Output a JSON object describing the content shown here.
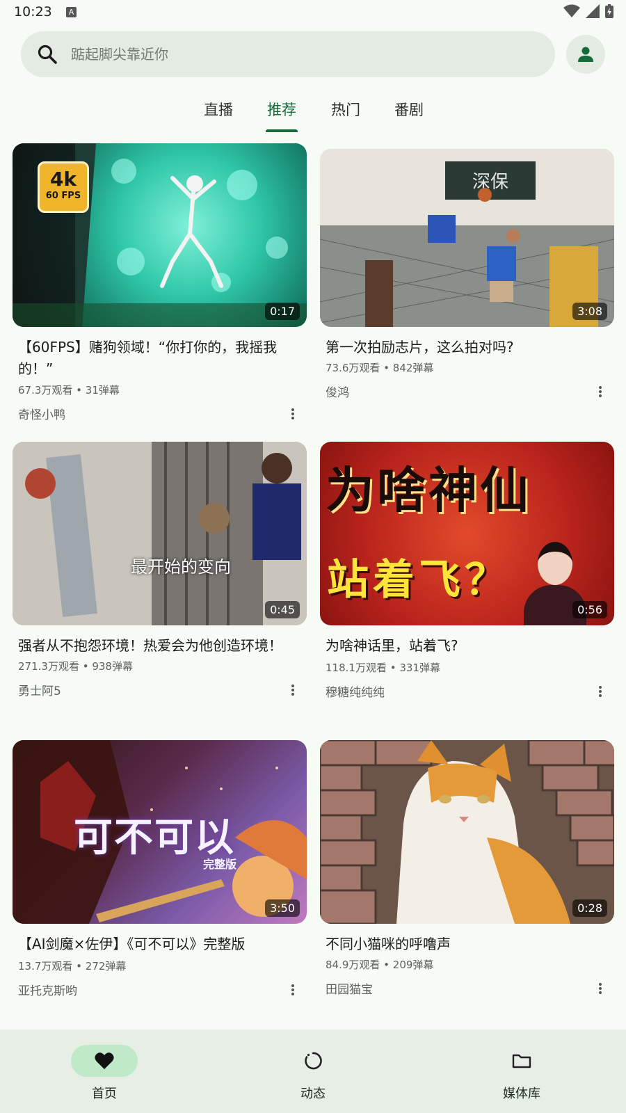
{
  "status": {
    "time": "10:23"
  },
  "search": {
    "placeholder": "踮起脚尖靠近你"
  },
  "tabs": [
    {
      "label": "直播",
      "active": false
    },
    {
      "label": "推荐",
      "active": true
    },
    {
      "label": "热门",
      "active": false
    },
    {
      "label": "番剧",
      "active": false
    }
  ],
  "videos": [
    {
      "title": "【60FPS】赌狗领域！“你打你的，我摇我的！”",
      "meta": "67.3万观看 • 31弹幕",
      "author": "奇怪小鸭",
      "duration": "0:17",
      "thumb_badge": "4k",
      "thumb_badge_sub": "60 FPS"
    },
    {
      "title": "第一次拍励志片，这么拍对吗?",
      "meta": "73.6万观看 • 842弹幕",
      "author": "俊鸿",
      "duration": "3:08",
      "thumb_text": "深保"
    },
    {
      "title": "强者从不抱怨环境！热爱会为他创造环境！",
      "meta": "271.3万观看 • 938弹幕",
      "author": "勇士阿5",
      "duration": "0:45",
      "thumb_text": "最开始的变向"
    },
    {
      "title": "为啥神话里，站着飞?",
      "meta": "118.1万观看 • 331弹幕",
      "author": "穆糖纯纯纯",
      "duration": "0:56",
      "thumb_text": "为啥神仙",
      "thumb_text2": "站着飞？"
    },
    {
      "title": "【AI剑魔×佐伊】《可不可以》完整版",
      "meta": "13.7万观看 • 272弹幕",
      "author": "亚托克斯哟",
      "duration": "3:50",
      "thumb_text": "可不可以",
      "thumb_text2": "完整版"
    },
    {
      "title": "不同小猫咪的呼噜声",
      "meta": "84.9万观看 • 209弹幕",
      "author": "田园猫宝",
      "duration": "0:28"
    }
  ],
  "nav": [
    {
      "label": "首页",
      "icon": "heart-icon",
      "active": true
    },
    {
      "label": "动态",
      "icon": "refresh-icon",
      "active": false
    },
    {
      "label": "媒体库",
      "icon": "folder-icon",
      "active": false
    }
  ],
  "colors": {
    "accent": "#176b3a",
    "background": "#f6fbf5",
    "nav_active": "#bfe9c8"
  }
}
